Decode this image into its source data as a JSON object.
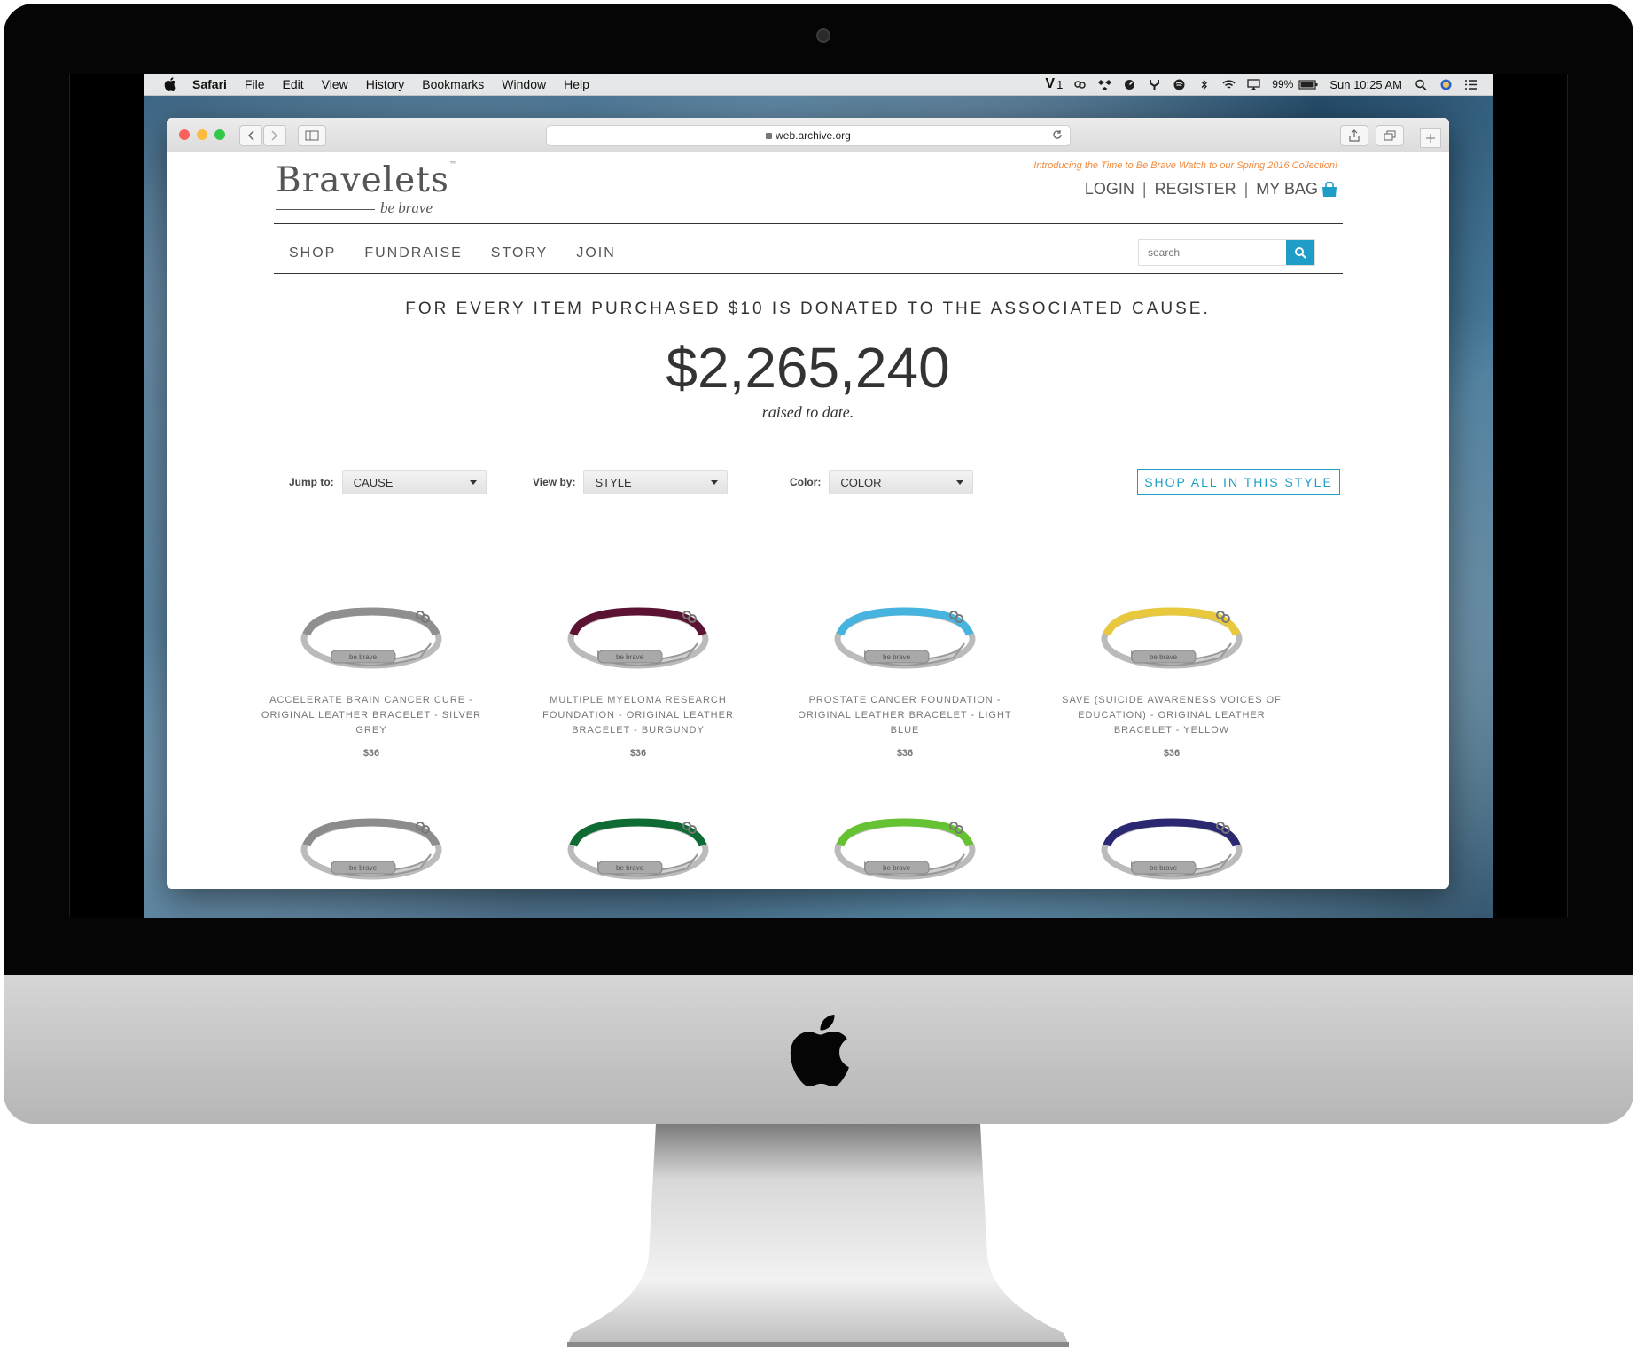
{
  "menubar": {
    "app": "Safari",
    "items": [
      "File",
      "Edit",
      "View",
      "History",
      "Bookmarks",
      "Window",
      "Help"
    ],
    "battery": "99%",
    "clock": "Sun 10:25 AM",
    "vpn_label": "V",
    "vpn_count": "1"
  },
  "browser": {
    "url": "web.archive.org"
  },
  "site": {
    "logo": "Bravelets",
    "logo_tagline": "be brave",
    "logo_tm": "™",
    "promo": "Introducing the Time to Be Brave Watch to our Spring 2016 Collection!",
    "account": {
      "login": "LOGIN",
      "register": "REGISTER",
      "bag": "MY BAG",
      "sep": "|"
    },
    "nav": [
      "SHOP",
      "FUNDRAISE",
      "STORY",
      "JOIN"
    ],
    "search_placeholder": "search",
    "donation_text": "FOR EVERY ITEM PURCHASED $10 IS DONATED TO THE ASSOCIATED CAUSE.",
    "total_raised": "$2,265,240",
    "raised_caption": "raised to date.",
    "filters": {
      "jump_label": "Jump to:",
      "jump_value": "CAUSE",
      "view_label": "View by:",
      "view_value": "STYLE",
      "color_label": "Color:",
      "color_value": "COLOR"
    },
    "shop_all": "SHOP ALL IN THIS STYLE",
    "bracelet_engraving": "be brave",
    "products": [
      {
        "name": "ACCELERATE BRAIN CANCER CURE - ORIGINAL LEATHER BRACELET - SILVER GREY",
        "price": "$36",
        "color": "#8f8f8f"
      },
      {
        "name": "MULTIPLE MYELOMA RESEARCH FOUNDATION - ORIGINAL LEATHER BRACELET - BURGUNDY",
        "price": "$36",
        "color": "#5c1232"
      },
      {
        "name": "PROSTATE CANCER FOUNDATION - ORIGINAL LEATHER BRACELET - LIGHT BLUE",
        "price": "$36",
        "color": "#47b3df"
      },
      {
        "name": "SAVE (SUICIDE AWARENESS VOICES OF EDUCATION) - ORIGINAL LEATHER BRACELET - YELLOW",
        "price": "$36",
        "color": "#e8c93e"
      },
      {
        "name": "",
        "price": "",
        "color": "#8c8c8c"
      },
      {
        "name": "",
        "price": "",
        "color": "#0f6b34"
      },
      {
        "name": "",
        "price": "",
        "color": "#65c232"
      },
      {
        "name": "",
        "price": "",
        "color": "#2a2870"
      }
    ]
  },
  "colors": {
    "accent": "#1e9dc7",
    "promo": "#f28a3c"
  }
}
